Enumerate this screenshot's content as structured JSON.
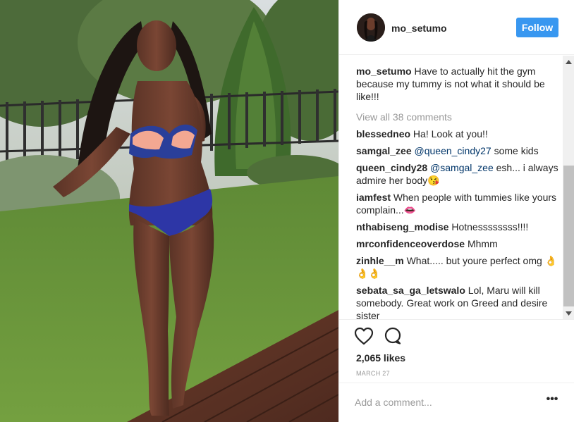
{
  "post": {
    "username": "mo_setumo",
    "follow_label": "Follow",
    "caption": {
      "username": "mo_setumo",
      "text": "Have to actually hit the gym because my tummy is not what it should be like!!!"
    },
    "view_all_comments": "View all 38 comments",
    "comments": [
      {
        "username": "blessedneo",
        "parts": [
          {
            "t": "Ha! Look at you!!"
          }
        ]
      },
      {
        "username": "samgal_zee",
        "parts": [
          {
            "t": "@queen_cindy27",
            "mention": true
          },
          {
            "t": " some kids"
          }
        ]
      },
      {
        "username": "queen_cindy28",
        "parts": [
          {
            "t": "@samgal_zee",
            "mention": true
          },
          {
            "t": " esh... i always admire her body😘"
          }
        ]
      },
      {
        "username": "iamfest",
        "parts": [
          {
            "t": "When people with tummies like yours complain...👄"
          }
        ]
      },
      {
        "username": "nthabiseng_modise",
        "parts": [
          {
            "t": "Hotnessssssss!!!!"
          }
        ]
      },
      {
        "username": "mrconfidenceoverdose",
        "parts": [
          {
            "t": "Mhmm"
          }
        ]
      },
      {
        "username": "zinhle__m",
        "parts": [
          {
            "t": "What..... but youre perfect omg 👌👌👌"
          }
        ]
      },
      {
        "username": "sebata_sa_ga_letswalo",
        "parts": [
          {
            "t": "Lol, Maru will kill somebody. Great work on Greed and desire sister"
          }
        ]
      }
    ],
    "likes": "2,065 likes",
    "date": "MARCH 27",
    "add_comment_placeholder": "Add a comment...",
    "more_label": "•••"
  },
  "icons": {
    "like": "heart-outline-icon",
    "comment": "speech-bubble-icon",
    "scroll_up": "triangle-up-icon",
    "scroll_down": "triangle-down-icon"
  },
  "colors": {
    "follow_button": "#3897f0",
    "mention": "#003569",
    "muted_text": "#999999",
    "text": "#262626"
  }
}
